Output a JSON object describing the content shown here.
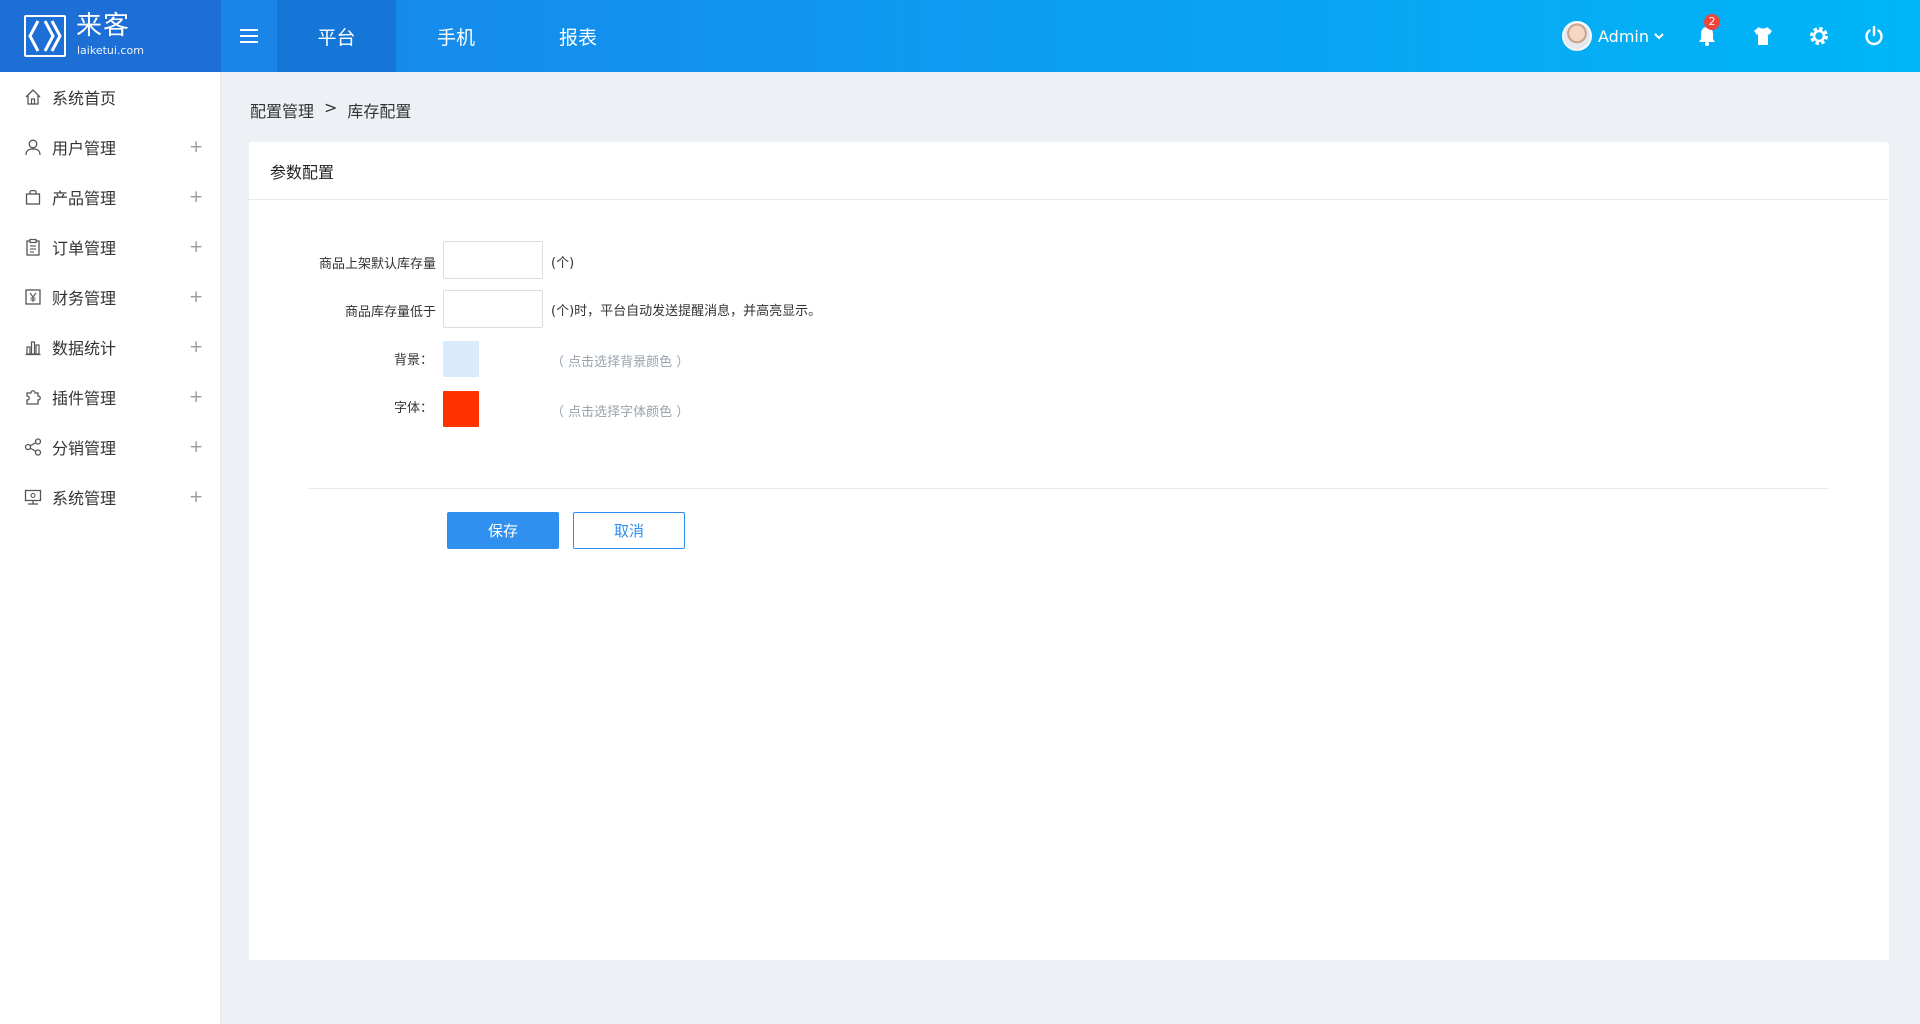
{
  "brand": {
    "name": "来客",
    "url": "laiketui.com",
    "color": "#1d6fd6"
  },
  "header": {
    "tabs": [
      {
        "label": "平台",
        "active": true
      },
      {
        "label": "手机",
        "active": false
      },
      {
        "label": "报表",
        "active": false
      }
    ],
    "user": {
      "name": "Admin"
    },
    "notifications": {
      "count": "2"
    },
    "icons": [
      "menu-icon",
      "bell-icon",
      "shirt-icon",
      "gear-icon",
      "power-icon"
    ]
  },
  "sidebar": {
    "items": [
      {
        "label": "系统首页",
        "icon": "home-icon",
        "expandable": false
      },
      {
        "label": "用户管理",
        "icon": "user-icon",
        "expandable": true,
        "toggle": "+"
      },
      {
        "label": "产品管理",
        "icon": "bag-icon",
        "expandable": true,
        "toggle": "+"
      },
      {
        "label": "订单管理",
        "icon": "clipboard-icon",
        "expandable": true,
        "toggle": "+"
      },
      {
        "label": "财务管理",
        "icon": "yen-icon",
        "expandable": true,
        "toggle": "+"
      },
      {
        "label": "数据统计",
        "icon": "bar-chart-icon",
        "expandable": true,
        "toggle": "+"
      },
      {
        "label": "插件管理",
        "icon": "puzzle-icon",
        "expandable": true,
        "toggle": "+"
      },
      {
        "label": "分销管理",
        "icon": "share-icon",
        "expandable": true,
        "toggle": "+"
      },
      {
        "label": "系统管理",
        "icon": "monitor-icon",
        "expandable": true,
        "toggle": "+"
      }
    ]
  },
  "breadcrumb": {
    "parent": "配置管理",
    "separator": ">",
    "current": "库存配置"
  },
  "panel": {
    "title": "参数配置",
    "form": {
      "default_stock": {
        "label": "商品上架默认库存量",
        "value": "",
        "suffix": "(个)"
      },
      "low_stock": {
        "label": "商品库存量低于",
        "value": "",
        "suffix": "(个)时，平台自动发送提醒消息，并高亮显示。"
      },
      "background": {
        "label": "背景：",
        "color": "#d9eafd",
        "hint": "（ 点击选择背景颜色 ）"
      },
      "font": {
        "label": "字体：",
        "color": "#ff3300",
        "hint": "（ 点击选择字体颜色 ）"
      }
    },
    "buttons": {
      "save": "保存",
      "cancel": "取消"
    }
  },
  "colors": {
    "accent": "#2f90f0",
    "header_start": "#1b7fe8",
    "header_end": "#00b6f7"
  }
}
